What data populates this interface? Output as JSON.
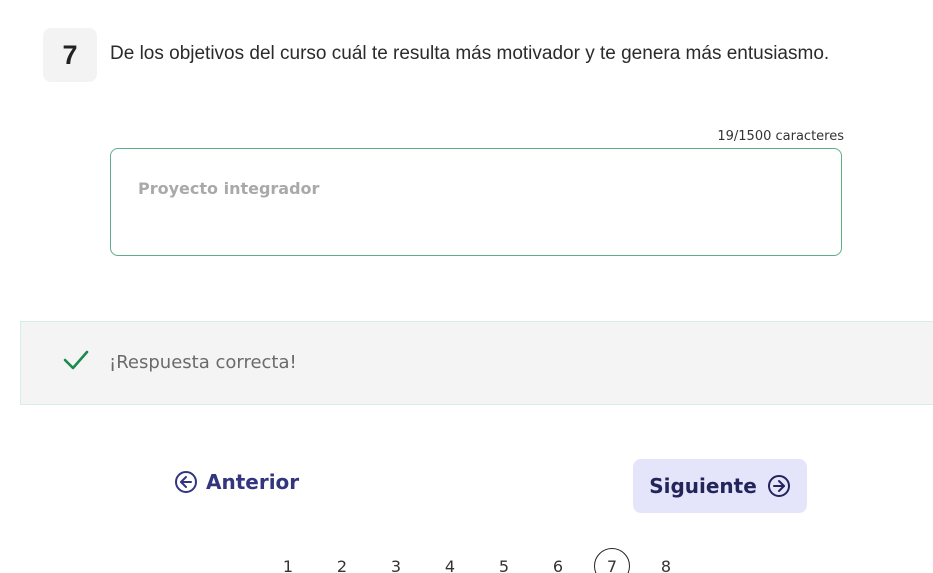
{
  "question": {
    "number": "7",
    "text": "De los objetivos del curso cuál te resulta más motivador y te genera más entusiasmo."
  },
  "answer": {
    "char_count": "19/1500 caracteres",
    "value": "Proyecto integrador"
  },
  "feedback": {
    "text": "¡Respuesta correcta!",
    "icon": "check-icon",
    "color": "#1a8a4e"
  },
  "navigation": {
    "prev_label": "Anterior",
    "next_label": "Siguiente",
    "accent": "#33357f",
    "next_bg": "#e4e4fb"
  },
  "pagination": {
    "pages": [
      "1",
      "2",
      "3",
      "4",
      "5",
      "6",
      "7",
      "8"
    ],
    "current": "7"
  }
}
